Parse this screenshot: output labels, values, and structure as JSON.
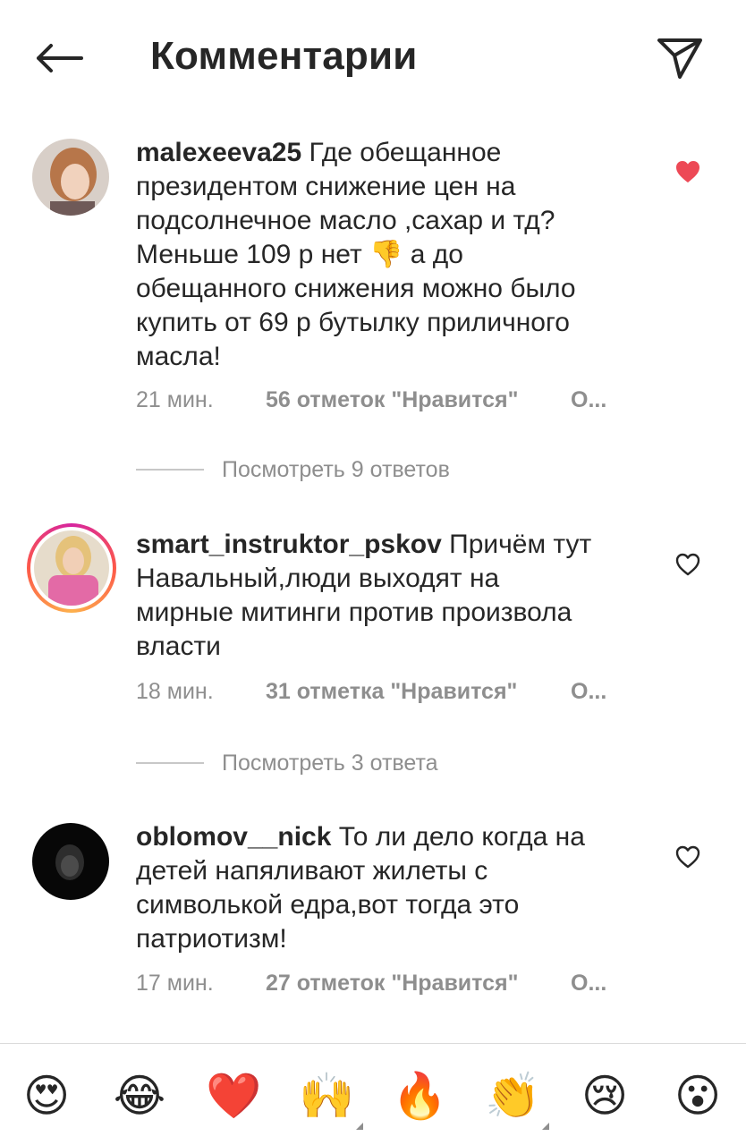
{
  "header": {
    "title": "Комментарии"
  },
  "comments": [
    {
      "username": "malexeeva25",
      "text_before_emoji": "Где обещанное президентом снижение цен на подсолнечное масло ,сахар и тд? Меньше 109 р нет ",
      "emoji": "👎",
      "text_after_emoji": " а до обещанного снижения можно было купить от 69 р бутылку приличного масла!",
      "time": "21 мин.",
      "likes": "56 отметок \"Нравится\"",
      "reply": "О...",
      "liked": true,
      "view_replies": "Посмотреть 9 ответов"
    },
    {
      "username": "smart_instruktor_pskov",
      "text": "Причём тут Навальный,люди выходят на мирные митинги против произвола власти",
      "time": "18 мин.",
      "likes": "31 отметка \"Нравится\"",
      "reply": "О...",
      "liked": false,
      "view_replies": "Посмотреть 3 ответа"
    },
    {
      "username": "oblomov__nick",
      "text": "То ли дело когда на детей напяливают жилеты с символькой едра,вот тогда это патриотизм!",
      "time": "17 мин.",
      "likes": "27 отметок \"Нравится\"",
      "reply": "О...",
      "liked": false
    }
  ],
  "emoji_bar": [
    {
      "name": "heart-eyes-emoji",
      "char": "😍"
    },
    {
      "name": "tears-of-joy-emoji",
      "char": "😂"
    },
    {
      "name": "red-heart-emoji",
      "char": "❤️"
    },
    {
      "name": "raising-hands-emoji",
      "char": "🙌"
    },
    {
      "name": "fire-emoji",
      "char": "🔥"
    },
    {
      "name": "clapping-hands-emoji",
      "char": "👏"
    },
    {
      "name": "crying-face-emoji",
      "char": "😢"
    },
    {
      "name": "surprised-face-emoji",
      "char": "😮"
    }
  ],
  "colors": {
    "text": "#262626",
    "muted": "#8e8e8e",
    "like_red": "#ed4956",
    "divider": "#dbdbdb"
  }
}
